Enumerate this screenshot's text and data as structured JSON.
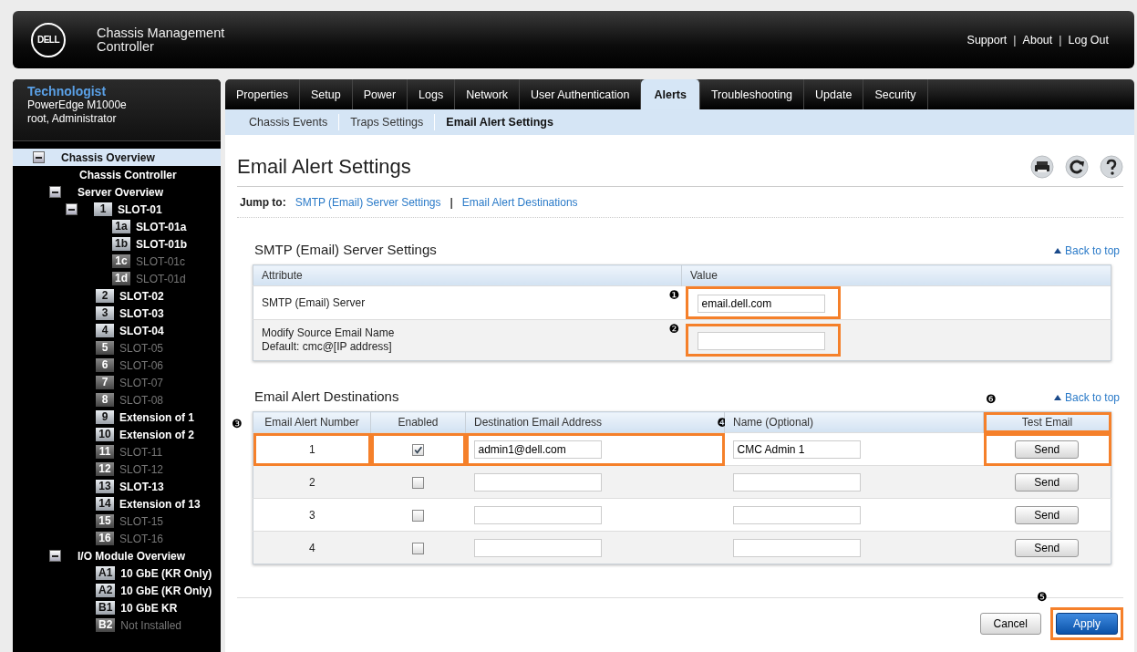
{
  "header": {
    "logo_text": "DELL",
    "product_lines": [
      "Chassis Management",
      "Controller"
    ],
    "links": [
      "Support",
      "About",
      "Log Out"
    ],
    "separator": "|"
  },
  "sidebar": {
    "title": "Technologist",
    "model": "PowerEdge M1000e",
    "user": "root, Administrator",
    "tree": [
      {
        "label": "Chassis Overview",
        "expanded": true,
        "selected": true,
        "children": [
          {
            "label": "Chassis Controller",
            "selected": false
          },
          {
            "label": "Server Overview",
            "expanded": true,
            "selected": false,
            "children": [
              {
                "badge": "1",
                "label": "SLOT-01",
                "expanded": true,
                "selected": false,
                "disabled": false,
                "children": [
                  {
                    "badge": "1a",
                    "label": "SLOT-01a",
                    "selected": false,
                    "disabled": false
                  },
                  {
                    "badge": "1b",
                    "label": "SLOT-01b",
                    "selected": false,
                    "disabled": false
                  },
                  {
                    "badge": "1c",
                    "label": "SLOT-01c",
                    "selected": false,
                    "disabled": true
                  },
                  {
                    "badge": "1d",
                    "label": "SLOT-01d",
                    "selected": false,
                    "disabled": true
                  }
                ]
              },
              {
                "badge": "2",
                "label": "SLOT-02",
                "selected": false,
                "disabled": false
              },
              {
                "badge": "3",
                "label": "SLOT-03",
                "selected": false,
                "disabled": false
              },
              {
                "badge": "4",
                "label": "SLOT-04",
                "selected": false,
                "disabled": false
              },
              {
                "badge": "5",
                "label": "SLOT-05",
                "selected": false,
                "disabled": true
              },
              {
                "badge": "6",
                "label": "SLOT-06",
                "selected": false,
                "disabled": true
              },
              {
                "badge": "7",
                "label": "SLOT-07",
                "selected": false,
                "disabled": true
              },
              {
                "badge": "8",
                "label": "SLOT-08",
                "selected": false,
                "disabled": true
              },
              {
                "badge": "9",
                "label": "Extension of 1",
                "selected": false,
                "disabled": false
              },
              {
                "badge": "10",
                "label": "Extension of 2",
                "selected": false,
                "disabled": false
              },
              {
                "badge": "11",
                "label": "SLOT-11",
                "selected": false,
                "disabled": true
              },
              {
                "badge": "12",
                "label": "SLOT-12",
                "selected": false,
                "disabled": true
              },
              {
                "badge": "13",
                "label": "SLOT-13",
                "selected": false,
                "disabled": false
              },
              {
                "badge": "14",
                "label": "Extension of 13",
                "selected": false,
                "disabled": false
              },
              {
                "badge": "15",
                "label": "SLOT-15",
                "selected": false,
                "disabled": true
              },
              {
                "badge": "16",
                "label": "SLOT-16",
                "selected": false,
                "disabled": true
              }
            ]
          },
          {
            "label": "I/O Module Overview",
            "expanded": true,
            "selected": false,
            "children": [
              {
                "badge": "A1",
                "label": "10 GbE (KR Only)",
                "selected": false,
                "disabled": false
              },
              {
                "badge": "A2",
                "label": "10 GbE (KR Only)",
                "selected": false,
                "disabled": false
              },
              {
                "badge": "B1",
                "label": "10 GbE KR",
                "selected": false,
                "disabled": false
              },
              {
                "badge": "B2",
                "label": "Not Installed",
                "selected": false,
                "disabled": true
              }
            ]
          }
        ]
      }
    ]
  },
  "tabs": [
    {
      "label": "Properties",
      "selected": false
    },
    {
      "label": "Setup",
      "selected": false
    },
    {
      "label": "Power",
      "selected": false
    },
    {
      "label": "Logs",
      "selected": false
    },
    {
      "label": "Network",
      "selected": false
    },
    {
      "label": "User Authentication",
      "selected": false
    },
    {
      "label": "Alerts",
      "selected": true
    },
    {
      "label": "Troubleshooting",
      "selected": false
    },
    {
      "label": "Update",
      "selected": false
    },
    {
      "label": "Security",
      "selected": false
    }
  ],
  "subtabs": [
    {
      "label": "Chassis Events",
      "selected": false
    },
    {
      "label": "Traps Settings",
      "selected": false
    },
    {
      "label": "Email Alert Settings",
      "selected": true
    }
  ],
  "page": {
    "title": "Email Alert Settings",
    "jump_label": "Jump to:",
    "jump_links": [
      "SMTP (Email) Server Settings",
      "Email Alert Destinations"
    ],
    "jump_separator": "|"
  },
  "smtp": {
    "heading": "SMTP (Email) Server Settings",
    "back_to_top": "Back to top",
    "columns": [
      "Attribute",
      "Value"
    ],
    "rows": [
      {
        "label_lines": [
          "SMTP (Email) Server"
        ],
        "value": "email.dell.com",
        "highlighted": true,
        "callout": "❶"
      },
      {
        "label_lines": [
          "Modify Source Email Name",
          "Default: cmc@[IP address]"
        ],
        "highlighted": true,
        "callout": "❷"
      }
    ]
  },
  "destinations": {
    "heading": "Email Alert Destinations",
    "back_to_top": "Back to top",
    "columns": [
      {
        "label": "Email Alert Number",
        "highlighted": false
      },
      {
        "label": "Enabled",
        "highlighted": false
      },
      {
        "label": "Destination Email Address",
        "highlighted": false,
        "callout": "❹"
      },
      {
        "label": "Name (Optional)",
        "highlighted": false
      },
      {
        "label": "Test Email",
        "highlighted": true,
        "callout": "❻"
      }
    ],
    "rows": [
      {
        "number": "1",
        "enabled": true,
        "address": "admin1@dell.com",
        "name": "CMC Admin 1",
        "send": "Send",
        "highlighted": true,
        "callout": "❸"
      },
      {
        "number": "2",
        "enabled": false,
        "send": "Send",
        "highlighted": false
      },
      {
        "number": "3",
        "enabled": false,
        "send": "Send",
        "highlighted": false
      },
      {
        "number": "4",
        "enabled": false,
        "send": "Send",
        "highlighted": false
      }
    ]
  },
  "buttons": [
    {
      "label": "Cancel",
      "kind": "secondary",
      "highlighted": false
    },
    {
      "label": "Apply",
      "kind": "primary",
      "highlighted": true,
      "callout": "❺"
    }
  ]
}
